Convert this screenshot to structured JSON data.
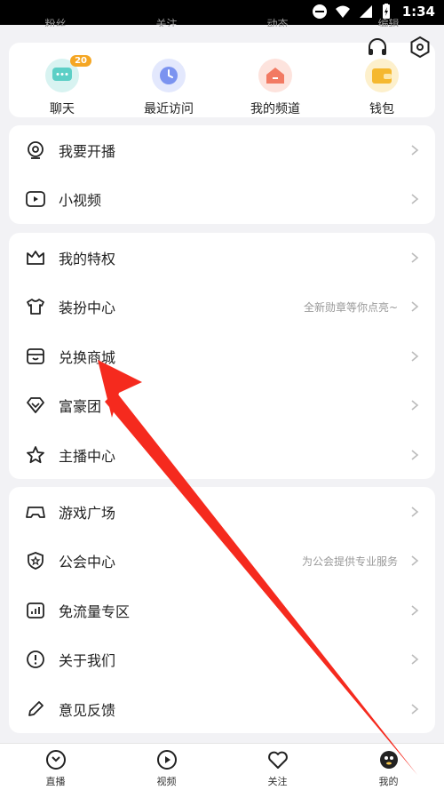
{
  "status_bar": {
    "time": "1:34"
  },
  "top_stats": [
    "粉丝",
    "关注",
    "动态",
    "编辑"
  ],
  "quick_actions": [
    {
      "label": "聊天",
      "badge": "20",
      "color": "#7fd9d3",
      "icon": "chat-icon"
    },
    {
      "label": "最近访问",
      "color": "#8fa5f5",
      "icon": "clock-icon"
    },
    {
      "label": "我的频道",
      "color": "#f5917a",
      "icon": "home-icon"
    },
    {
      "label": "钱包",
      "color": "#f5c64a",
      "icon": "wallet-icon"
    }
  ],
  "section1": [
    {
      "label": "我要开播",
      "icon": "live-camera-icon"
    },
    {
      "label": "小视频",
      "icon": "video-icon"
    }
  ],
  "section2": [
    {
      "label": "我的特权",
      "icon": "crown-icon"
    },
    {
      "label": "装扮中心",
      "desc": "全新勋章等你点亮~",
      "icon": "shirt-icon"
    },
    {
      "label": "兑换商城",
      "icon": "store-icon"
    },
    {
      "label": "富豪团",
      "icon": "diamond-icon"
    },
    {
      "label": "主播中心",
      "icon": "star-icon"
    }
  ],
  "section3": [
    {
      "label": "游戏广场",
      "icon": "gamepad-icon"
    },
    {
      "label": "公会中心",
      "desc": "为公会提供专业服务",
      "icon": "shield-star-icon"
    },
    {
      "label": "免流量专区",
      "icon": "data-free-icon"
    },
    {
      "label": "关于我们",
      "icon": "info-icon"
    },
    {
      "label": "意见反馈",
      "icon": "pen-icon"
    }
  ],
  "tabs": [
    {
      "label": "直播",
      "icon": "live-tab-icon"
    },
    {
      "label": "视频",
      "icon": "video-tab-icon"
    },
    {
      "label": "关注",
      "icon": "heart-tab-icon"
    },
    {
      "label": "我的",
      "icon": "mine-tab-icon"
    }
  ],
  "annotation_color": "#f52a1e"
}
